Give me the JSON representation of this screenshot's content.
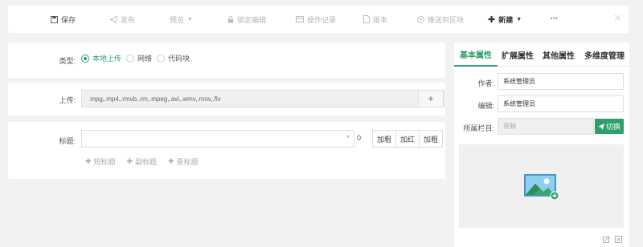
{
  "toolbar": {
    "save": "保存",
    "publish": "发布",
    "preview": "预览",
    "lock_edit": "锁定编辑",
    "history": "操作记录",
    "version": "版本",
    "push": "推送到区块",
    "new": "新建",
    "more": "•••"
  },
  "form": {
    "type_label": "类型:",
    "type_options": [
      "本地上传",
      "网络",
      "代码块"
    ],
    "type_selected": "本地上传",
    "upload_label": "上传:",
    "upload_formats": ".mpg,.mp4,.rmvb,.rm,.mpeg,.avi,.wmv,.mov,.flv",
    "title_label": "标题:",
    "title_value": "",
    "title_required": "*",
    "title_count": "0",
    "format_buttons": [
      "加粗",
      "加红",
      "加粗"
    ],
    "sub_links": [
      "短标题",
      "副标题",
      "原标题"
    ]
  },
  "sidebar": {
    "tabs": [
      "基本属性",
      "扩展属性",
      "其他属性",
      "多维度管理"
    ],
    "active_tab": "基本属性",
    "author_label": "作者:",
    "author_value": "系统管理员",
    "editor_label": "编辑:",
    "editor_value": "系统管理员",
    "column_label": "所属栏目:",
    "column_placeholder": "视频",
    "switch_label": "切换"
  },
  "colors": {
    "accent": "#2e9e6a",
    "background": "#f2f2f2",
    "required": "#e55555"
  }
}
